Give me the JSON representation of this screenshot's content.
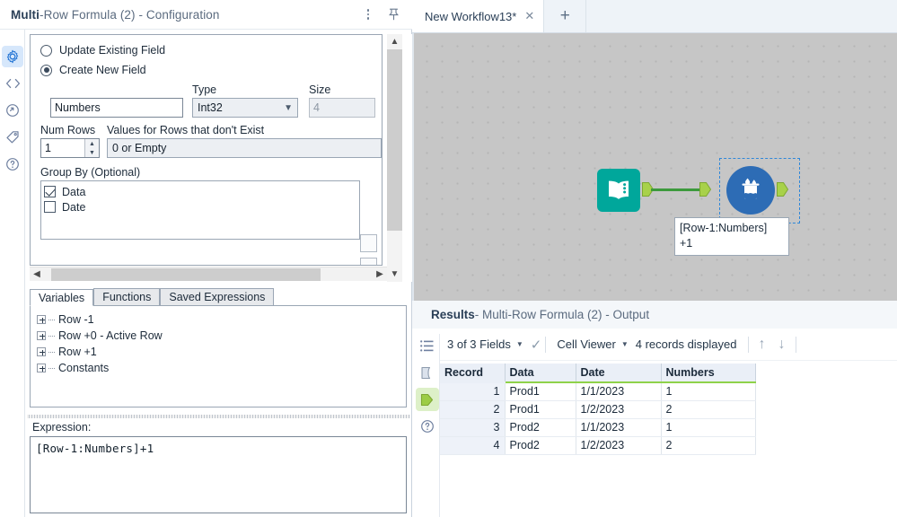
{
  "config_panel": {
    "title_bold": "Multi",
    "title_rest": "-Row Formula (2) - Configuration",
    "menu_icon": "kebab-menu-icon",
    "pin_icon": "pin-icon",
    "rail": [
      {
        "name": "gear-icon",
        "label": "Configuration"
      },
      {
        "name": "code-icon",
        "label": "Annotation"
      },
      {
        "name": "refresh-circle-icon",
        "label": "Cache"
      },
      {
        "name": "tag-icon",
        "label": "Tags"
      },
      {
        "name": "help-circle-icon",
        "label": "Help"
      }
    ],
    "update_existing_field": "Update Existing Field",
    "create_new_field": "Create New  Field",
    "field_name_value": "Numbers",
    "type_label": "Type",
    "type_value": "Int32",
    "size_label": "Size",
    "size_value": "4",
    "num_rows_label": "Num Rows",
    "num_rows_value": "1",
    "values_rows_label": "Values for Rows that don't Exist",
    "values_rows_value": "0 or Empty",
    "group_by_label": "Group By (Optional)",
    "group_by_items": [
      {
        "label": "Data",
        "checked": true
      },
      {
        "label": "Date",
        "checked": false
      }
    ],
    "tabs": [
      {
        "label": "Variables",
        "active": true
      },
      {
        "label": "Functions",
        "active": false
      },
      {
        "label": "Saved Expressions",
        "active": false
      }
    ],
    "variables_tree": [
      "Row -1",
      "Row +0 - Active Row",
      "Row +1",
      "Constants"
    ],
    "expression_label": "Expression:",
    "expression_value": "[Row-1:Numbers]+1"
  },
  "workflow": {
    "tab_title": "New Workflow13*",
    "close_icon": "close-icon",
    "add_tab_label": "+",
    "tools": [
      {
        "name": "input-data-tool",
        "icon": "book-icon",
        "color": "#00a79b"
      },
      {
        "name": "multi-row-formula-tool",
        "icon": "beaker-droplet-icon",
        "color": "#2d6cb5"
      }
    ],
    "annotation_line1": "[Row-1:Numbers]",
    "annotation_line2": "+1",
    "wire_color": "#3c9a3c",
    "anchor_color": "#a8d14a",
    "selection_color": "#2f87d8"
  },
  "results": {
    "title_bold": "Results",
    "title_rest": " - Multi-Row Formula (2) - Output",
    "rail": [
      {
        "name": "list-icon"
      },
      {
        "name": "input-anchor-icon"
      },
      {
        "name": "output-anchor-icon"
      },
      {
        "name": "help-circle-icon"
      }
    ],
    "toolbar": {
      "fields_label": "3 of 3 Fields",
      "check_icon": "check-icon",
      "viewer_label": "Cell Viewer",
      "records_label": "4 records displayed",
      "up_icon": "arrow-up-icon",
      "down_icon": "arrow-down-icon"
    },
    "table": {
      "columns": [
        "Record",
        "Data",
        "Date",
        "Numbers"
      ],
      "rows": [
        [
          "1",
          "Prod1",
          "1/1/2023",
          "1"
        ],
        [
          "2",
          "Prod1",
          "1/2/2023",
          "2"
        ],
        [
          "3",
          "Prod2",
          "1/1/2023",
          "1"
        ],
        [
          "4",
          "Prod2",
          "1/2/2023",
          "2"
        ]
      ]
    }
  }
}
